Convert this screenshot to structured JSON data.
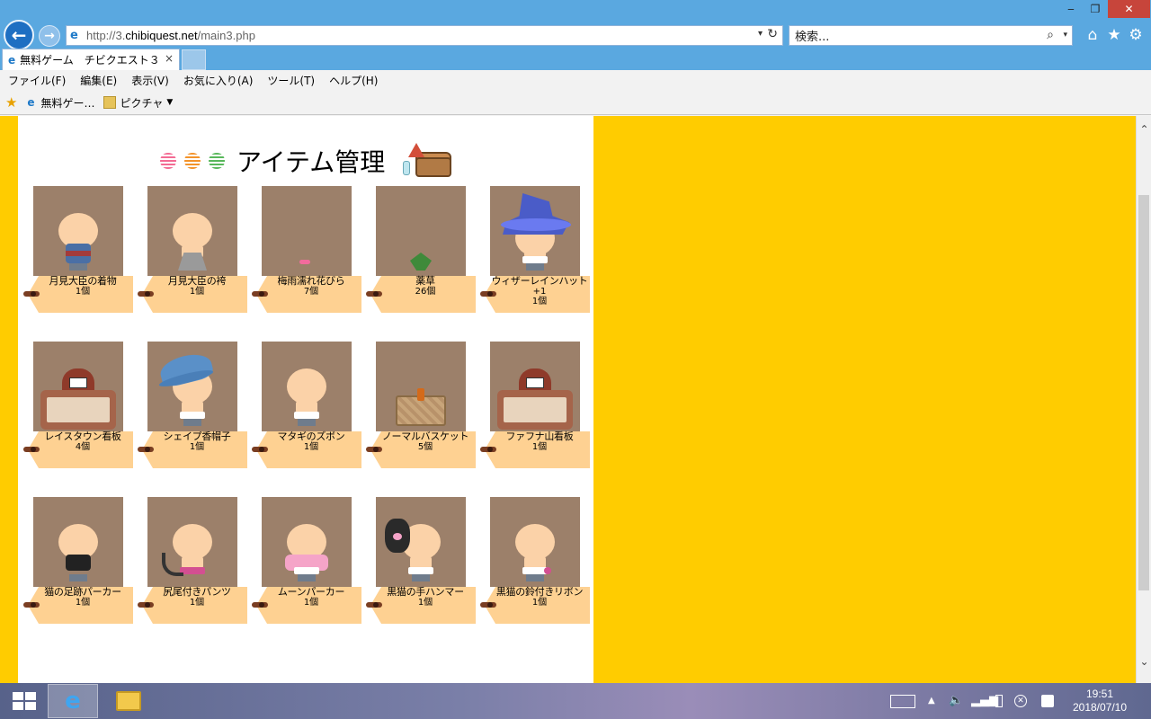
{
  "browser": {
    "address": {
      "prefix": "http://3.",
      "host": "chibiquest.net",
      "path": "/main3.php"
    },
    "search_placeholder": "検索...",
    "tab_title": "無料ゲーム　チビクエスト３",
    "tab_close": "×",
    "menu": [
      "ファイル(F)",
      "編集(E)",
      "表示(V)",
      "お気に入り(A)",
      "ツール(T)",
      "ヘルプ(H)"
    ],
    "favorites": [
      {
        "label": "無料ゲー…",
        "icon": "ie-page-icon"
      },
      {
        "label": "ピクチャ",
        "icon": "folder-icon"
      }
    ],
    "window_controls": {
      "minimize": "‒",
      "maximize": "❐",
      "close": "✕"
    }
  },
  "page": {
    "title": "アイテム管理",
    "items": [
      {
        "name": "月見大臣の着物",
        "count": "1個",
        "art": "kimono"
      },
      {
        "name": "月見大臣の袴",
        "count": "1個",
        "art": "hakama"
      },
      {
        "name": "梅雨濡れ花びら",
        "count": "7個",
        "art": "petal"
      },
      {
        "name": "薬草",
        "count": "26個",
        "art": "herb"
      },
      {
        "name": "ウィザーレインハット",
        "plus": "+1",
        "count": "1個",
        "art": "wizard-hat"
      },
      {
        "name": "レイスタウン看板",
        "count": "4個",
        "art": "sign"
      },
      {
        "name": "シェイプ香帽子",
        "count": "1個",
        "art": "fedora"
      },
      {
        "name": "マタギのズボン",
        "count": "1個",
        "art": "plain"
      },
      {
        "name": "ノーマルバスケット",
        "count": "5個",
        "art": "basket"
      },
      {
        "name": "ファフナ山看板",
        "count": "1個",
        "art": "sign"
      },
      {
        "name": "猫の足跡パーカー",
        "count": "1個",
        "art": "hoodie-black"
      },
      {
        "name": "尻尾付きパンツ",
        "count": "1個",
        "art": "tail"
      },
      {
        "name": "ムーンパーカー",
        "count": "1個",
        "art": "hoodie-pink"
      },
      {
        "name": "黒猫の手ハンマー",
        "count": "1個",
        "art": "paw"
      },
      {
        "name": "黒猫の鈴付きリボン",
        "count": "1個",
        "art": "ribbon"
      }
    ]
  },
  "taskbar": {
    "time": "19:51",
    "date": "2018/07/10"
  },
  "colors": {
    "background": "#ffcc00",
    "thumb": "#9c806a",
    "tag": "#fed192"
  }
}
